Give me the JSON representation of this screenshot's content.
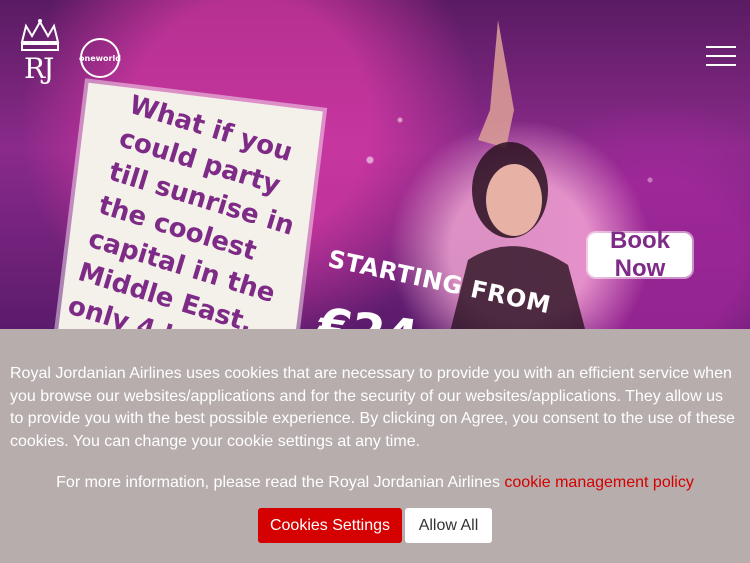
{
  "header": {
    "brand_mark": "RJ",
    "alliance_logo_text": "oneworld",
    "menu_icon": "hamburger-menu-icon"
  },
  "hero": {
    "promo_text": "What if you could party till sunrise in the coolest capital in the Middle East, only 4 h...",
    "starting_from": "STARTING FROM",
    "price_text": "€24",
    "book_now_label": "Book Now"
  },
  "cookie_banner": {
    "body_text": "Royal Jordanian Airlines uses cookies that are necessary to provide you with an efficient service when you browse our websites/applications and for the security of our websites/applications. They allow us to provide you with the best possible experience. By clicking on Agree, you consent to the use of these cookies. You can change your cookie settings at any time.",
    "more_info_text": "For more information, please read the Royal Jordanian Airlines ",
    "policy_link_label": "cookie management policy",
    "settings_button_label": "Cookies Settings",
    "allow_all_button_label": "Allow All"
  },
  "colors": {
    "accent_red": "#d50000",
    "banner_bg": "#b7adad",
    "promo_purple": "#7d2b86"
  }
}
